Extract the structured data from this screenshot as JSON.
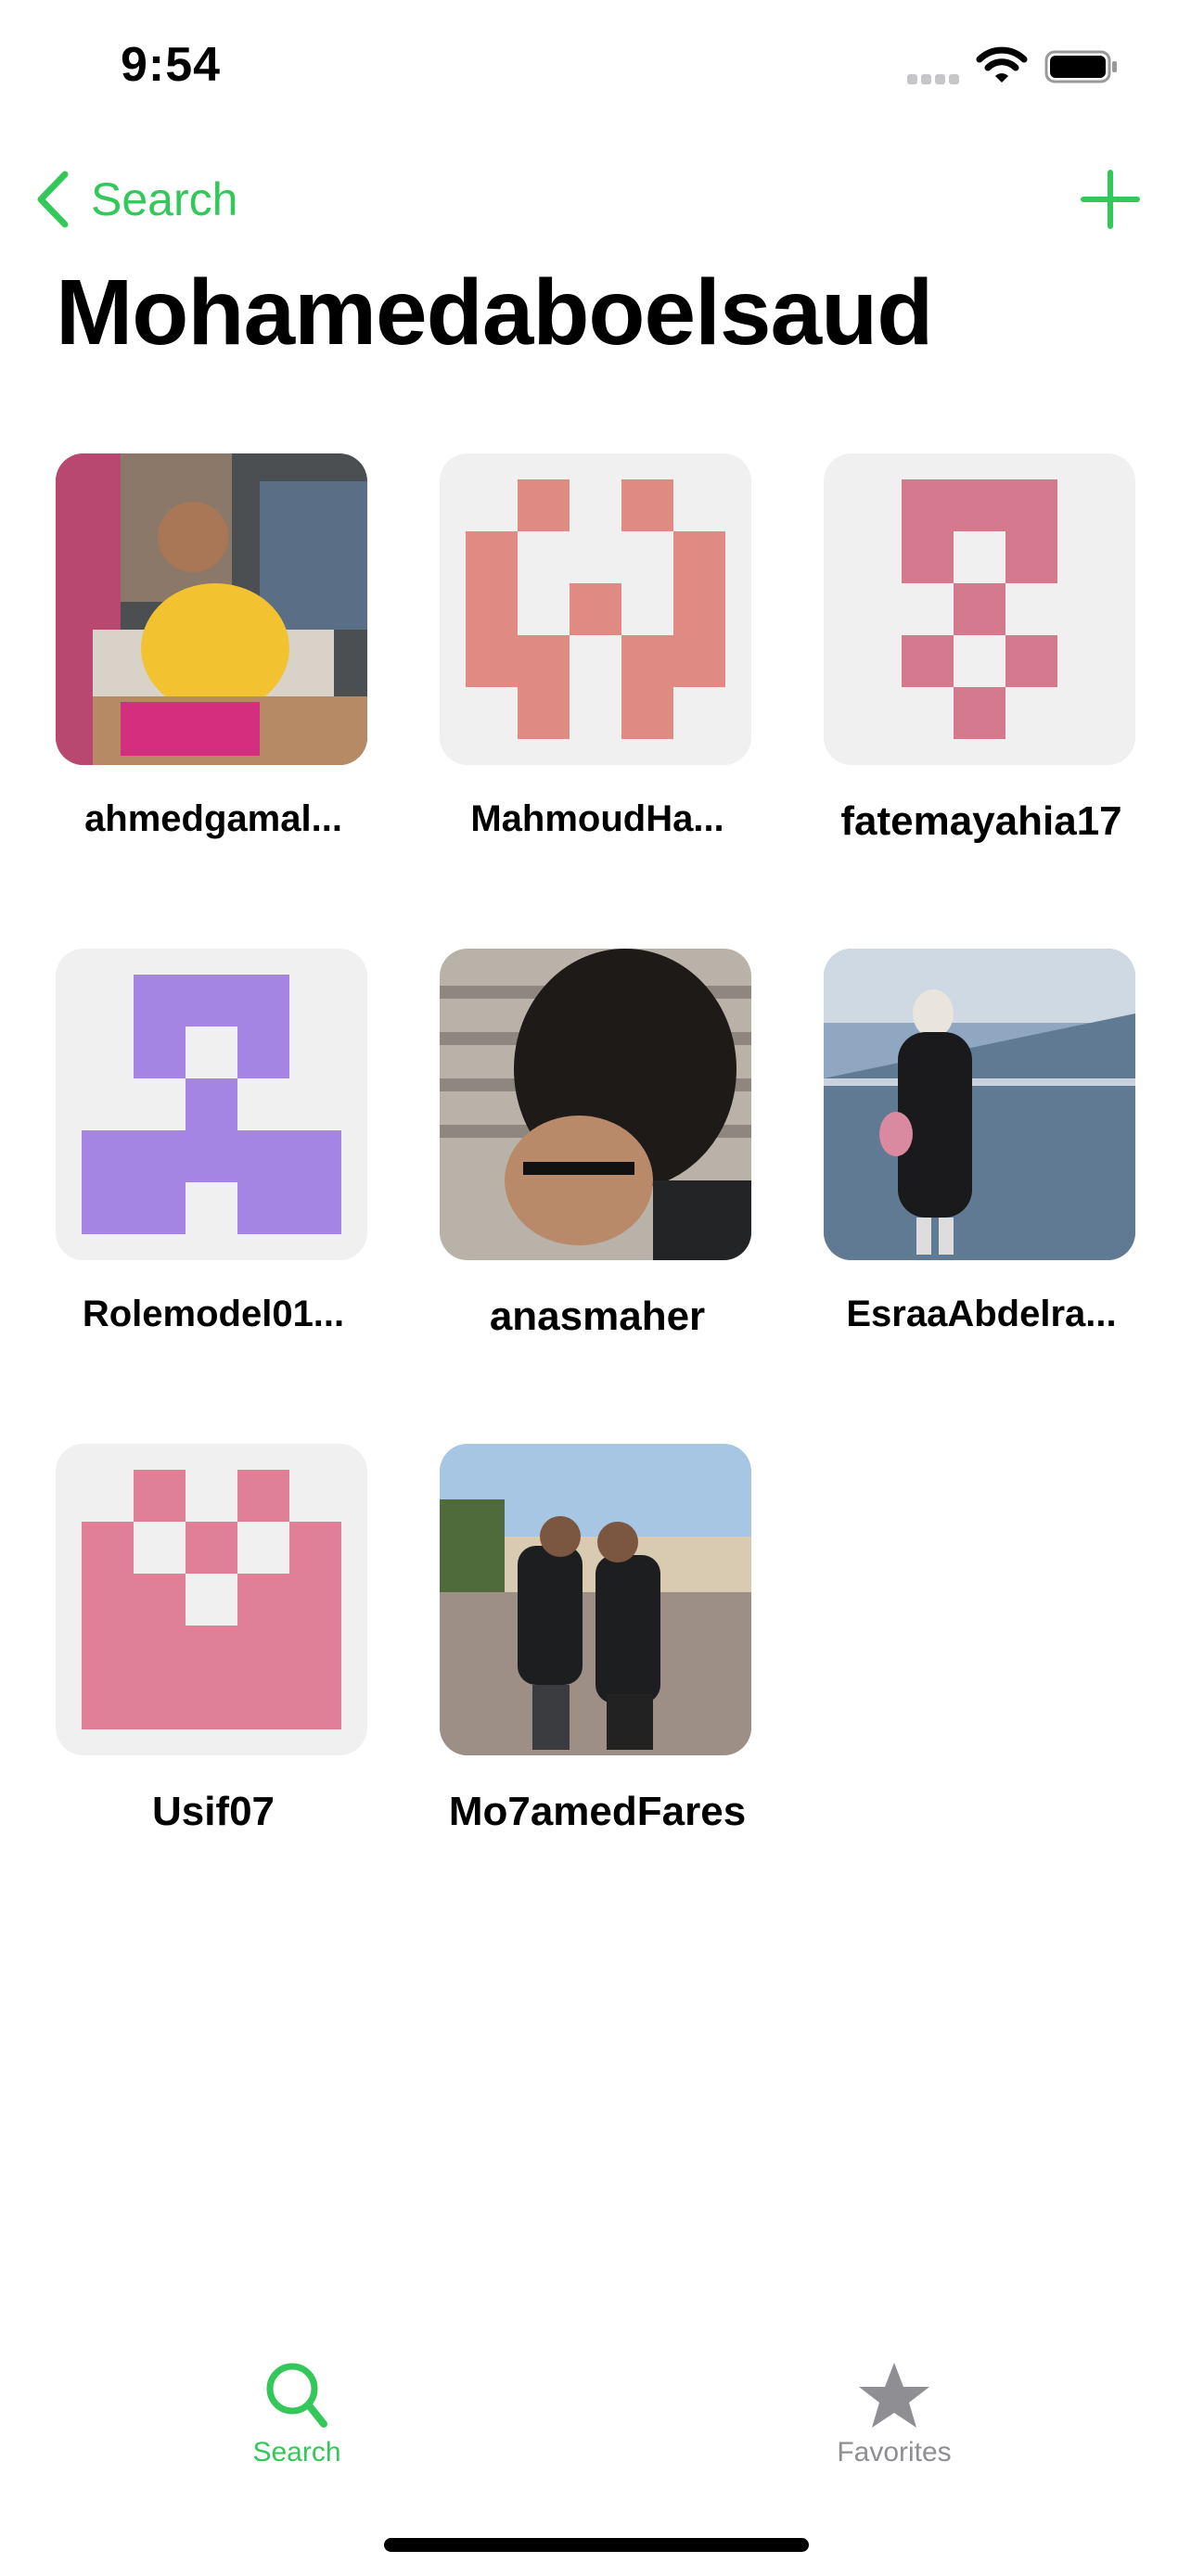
{
  "status_bar": {
    "time": "9:54"
  },
  "nav": {
    "back_label": "Search",
    "add_icon": "plus-icon",
    "accent_color": "#34c759"
  },
  "page_title": "Mohamedaboelsaud",
  "users": [
    {
      "name": "ahmedgamal...",
      "avatar": "photo"
    },
    {
      "name": "MahmoudHa...",
      "avatar": "identicon",
      "color": "#e08a84"
    },
    {
      "name": "fatemayahia17",
      "avatar": "identicon",
      "color": "#d5798e"
    },
    {
      "name": "Rolemodel01...",
      "avatar": "identicon",
      "color": "#a585e3"
    },
    {
      "name": "anasmaher",
      "avatar": "photo"
    },
    {
      "name": "EsraaAbdelra...",
      "avatar": "photo"
    },
    {
      "name": "Usif07",
      "avatar": "identicon",
      "color": "#e07f98"
    },
    {
      "name": "Mo7amedFares",
      "avatar": "photo"
    }
  ],
  "tabs": [
    {
      "label": "Search",
      "icon": "search-icon",
      "active": true
    },
    {
      "label": "Favorites",
      "icon": "star-icon",
      "active": false
    }
  ]
}
